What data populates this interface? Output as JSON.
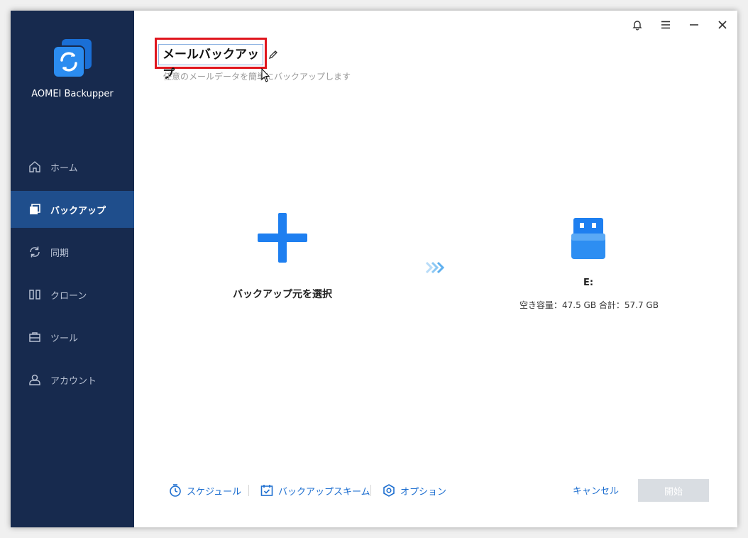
{
  "app": {
    "name": "AOMEI Backupper"
  },
  "sidebar": {
    "items": [
      {
        "label": "ホーム",
        "icon": "home-icon"
      },
      {
        "label": "バックアップ",
        "icon": "backup-icon",
        "active": true
      },
      {
        "label": "同期",
        "icon": "sync-icon"
      },
      {
        "label": "クローン",
        "icon": "clone-icon"
      },
      {
        "label": "ツール",
        "icon": "tools-icon"
      },
      {
        "label": "アカウント",
        "icon": "account-icon"
      }
    ]
  },
  "titlebar": {
    "icons": [
      "bell-icon",
      "menu-icon",
      "minimize-icon",
      "close-icon"
    ]
  },
  "task": {
    "name": "メールバックアップ",
    "description": "任意のメールデータを簡単にバックアップします"
  },
  "source": {
    "label": "バックアップ元を選択"
  },
  "target": {
    "drive": "E:",
    "info": "空き容量：47.5 GB 合計：57.7 GB"
  },
  "footer": {
    "schedule": "スケジュール",
    "scheme": "バックアップスキーム",
    "options": "オプション",
    "cancel": "キャンセル",
    "start": "開始"
  },
  "colors": {
    "sidebar_bg": "#172a4e",
    "sidebar_active": "#1f4e8c",
    "accent": "#1e6fd0",
    "highlight_box": "#e0161e"
  }
}
